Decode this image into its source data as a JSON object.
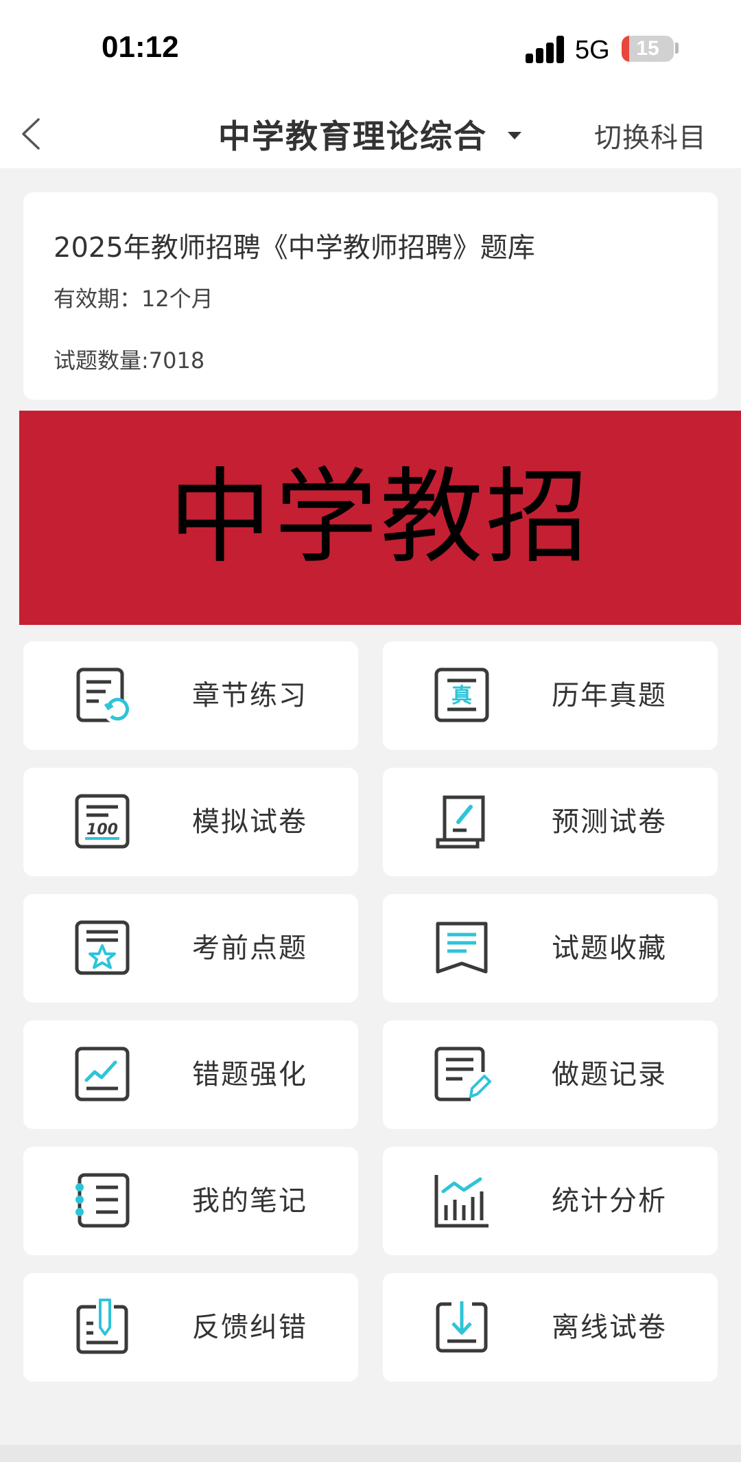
{
  "status_bar": {
    "time": "01:12",
    "network": "5G",
    "battery": "15",
    "battery_level": 0.15
  },
  "nav": {
    "title": "中学教育理论综合",
    "right_action": "切换科目",
    "back_icon": "chevron-left-icon",
    "dropdown_icon": "caret-down-icon"
  },
  "info_card": {
    "title": "2025年教师招聘《中学教师招聘》题库",
    "validity": "有效期：12个月",
    "question_count": "试题数量:7018"
  },
  "banner": {
    "text": "中学教招",
    "bg_color": "#c41f33"
  },
  "menu": [
    {
      "label": "章节练习",
      "icon": "chapter-practice-icon"
    },
    {
      "label": "历年真题",
      "icon": "past-exam-icon"
    },
    {
      "label": "模拟试卷",
      "icon": "mock-paper-icon"
    },
    {
      "label": "预测试卷",
      "icon": "prediction-paper-icon"
    },
    {
      "label": "考前点题",
      "icon": "key-points-icon"
    },
    {
      "label": "试题收藏",
      "icon": "favorites-icon"
    },
    {
      "label": "错题强化",
      "icon": "wrong-questions-icon"
    },
    {
      "label": "做题记录",
      "icon": "practice-record-icon"
    },
    {
      "label": "我的笔记",
      "icon": "notes-icon"
    },
    {
      "label": "统计分析",
      "icon": "statistics-icon"
    },
    {
      "label": "反馈纠错",
      "icon": "feedback-icon"
    },
    {
      "label": "离线试卷",
      "icon": "offline-paper-icon"
    }
  ],
  "colors": {
    "accent": "#2ec4d8",
    "icon_stroke": "#3a3a3a"
  }
}
